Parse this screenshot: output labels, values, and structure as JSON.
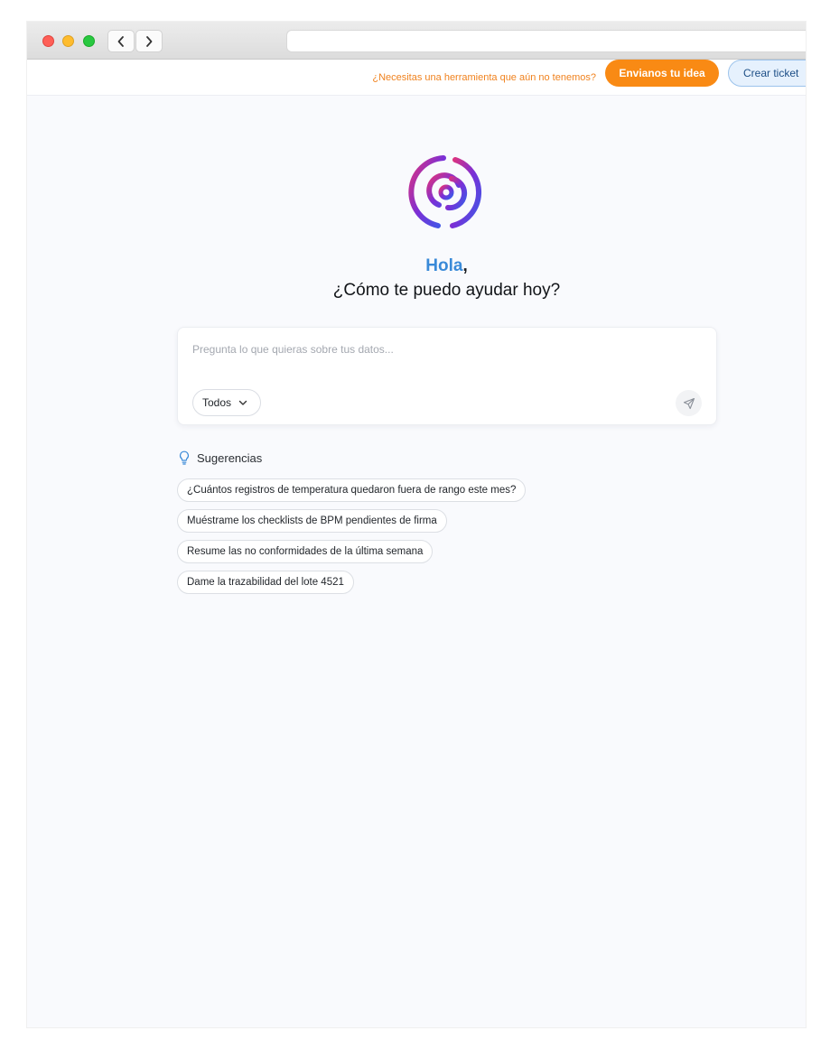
{
  "browser": {
    "address": "",
    "back_icon": "chevron-left-icon",
    "forward_icon": "chevron-right-icon"
  },
  "topbar": {
    "question": "¿Necesitas una herramienta que aún no tenemos?",
    "idea_button": "Envianos tu idea",
    "ticket_button": "Crear ticket"
  },
  "hero": {
    "logo_icon": "spiral-logo-icon",
    "greeting_name": "Hola",
    "greeting_punct": ",",
    "subtitle": "¿Cómo te puedo ayudar hoy?"
  },
  "composer": {
    "placeholder": "Pregunta lo que quieras sobre tus datos...",
    "value": "",
    "scope_selected": "Todos",
    "send_icon": "send-icon"
  },
  "suggestions": {
    "title": "Sugerencias",
    "icon": "lightbulb-icon",
    "items": [
      "¿Cuántos registros de temperatura quedaron fuera de rango este mes?",
      "Muéstrame los checklists de BPM pendientes de firma",
      "Resume las no conformidades de la última semana",
      "Dame la trazabilidad del lote 4521"
    ]
  },
  "colors": {
    "accent_orange": "#f98a14",
    "greeting_blue": "#3a8ad8",
    "ticket_bg": "#e6f1fd",
    "logo_gradient_start": "#e0337c",
    "logo_gradient_mid": "#7b2fd6",
    "logo_gradient_end": "#3a5be8"
  }
}
